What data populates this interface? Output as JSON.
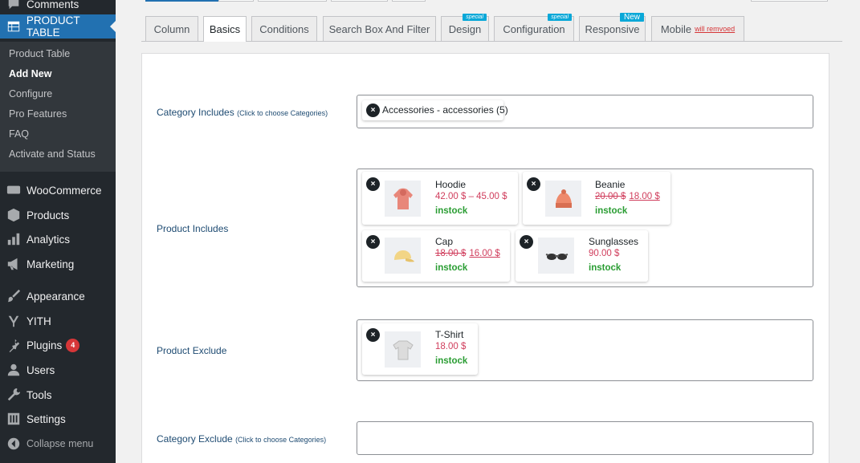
{
  "sidebar": {
    "comments_label": "Comments",
    "active_label": "PRODUCT TABLE",
    "submenu": [
      "Product Table",
      "Add New",
      "Configure",
      "Pro Features",
      "FAQ",
      "Activate and Status"
    ],
    "menu": [
      {
        "label": "WooCommerce",
        "icon": "woo-icon"
      },
      {
        "label": "Products",
        "icon": "cube-icon"
      },
      {
        "label": "Analytics",
        "icon": "bar-chart-icon"
      },
      {
        "label": "Marketing",
        "icon": "megaphone-icon"
      },
      {
        "label": "Appearance",
        "icon": "paintbrush-icon"
      },
      {
        "label": "YITH",
        "icon": "yith-icon"
      },
      {
        "label": "Plugins",
        "icon": "plug-icon",
        "badge": "4"
      },
      {
        "label": "Users",
        "icon": "user-icon"
      },
      {
        "label": "Tools",
        "icon": "wrench-icon"
      },
      {
        "label": "Settings",
        "icon": "sliders-icon"
      }
    ],
    "collapse_label": "Collapse menu"
  },
  "tabs": [
    {
      "label": "Column"
    },
    {
      "label": "Basics"
    },
    {
      "label": "Conditions"
    },
    {
      "label": "Search Box And Filter"
    },
    {
      "label": "Design",
      "badge": "special"
    },
    {
      "label": "Configuration",
      "badge": "special"
    },
    {
      "label": "Responsive",
      "badge": "New"
    },
    {
      "label": "Mobile",
      "note": "will remvoed"
    }
  ],
  "rows": {
    "category_includes": {
      "label": "Category Includes",
      "hint": "(Click to choose Categories)",
      "chip": "Accessories - accessories (5)"
    },
    "product_includes": {
      "label": "Product Includes"
    },
    "product_exclude": {
      "label": "Product Exclude"
    },
    "category_exclude": {
      "label": "Category Exclude",
      "hint": "(Click to choose Categories)"
    }
  },
  "products": {
    "hoodie": {
      "name": "Hoodie",
      "price": "42.00 $ – 45.00 $",
      "stock": "instock"
    },
    "beanie": {
      "name": "Beanie",
      "old_price": "20.00 $",
      "new_price": "18.00 $",
      "stock": "instock"
    },
    "cap": {
      "name": "Cap",
      "old_price": "18.00 $",
      "new_price": "16.00 $",
      "stock": "instock"
    },
    "sunglasses": {
      "name": "Sunglasses",
      "price": "90.00 $",
      "stock": "instock"
    },
    "tshirt": {
      "name": "T-Shirt",
      "price": "18.00 $",
      "stock": "instock"
    }
  },
  "remove_symbol": "×",
  "colors": {
    "sidebar_bg": "#23282d",
    "active_menu": "#2271b1",
    "price": "#d03d5c",
    "stock": "#2a9d33",
    "badge": "#0aa8d8"
  }
}
